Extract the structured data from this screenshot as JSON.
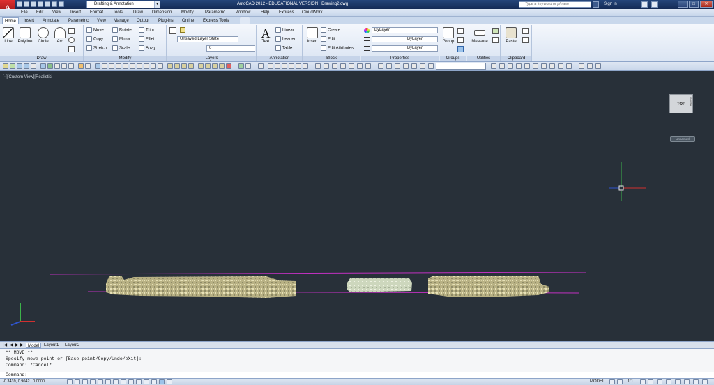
{
  "title_bar": {
    "app_title": "AutoCAD 2012 - EDUCATIONAL VERSION",
    "drawing_name": "Drawing2.dwg",
    "workspace": "Drafting & Annotation",
    "search_placeholder": "Type a keyword or phrase",
    "sign_in": "Sign In",
    "app_logo_letter": "A"
  },
  "menu": [
    "File",
    "Edit",
    "View",
    "Insert",
    "Format",
    "Tools",
    "Draw",
    "Dimension",
    "Modify",
    "Parametric",
    "Window",
    "Help",
    "Express",
    "CloudWorx"
  ],
  "ribbon_tabs": [
    "Home",
    "Insert",
    "Annotate",
    "Parametric",
    "View",
    "Manage",
    "Output",
    "Plug-ins",
    "Online",
    "Express Tools"
  ],
  "ribbon": {
    "draw": {
      "title": "Draw",
      "line": "Line",
      "polyline": "Polyline",
      "circle": "Circle",
      "arc": "Arc"
    },
    "modify": {
      "title": "Modify",
      "move": "Move",
      "rotate": "Rotate",
      "trim": "Trim",
      "copy": "Copy",
      "mirror": "Mirror",
      "fillet": "Fillet",
      "stretch": "Stretch",
      "scale": "Scale",
      "array": "Array"
    },
    "layers": {
      "title": "Layers",
      "layer_state": "Unsaved Layer State",
      "current_layer": "0"
    },
    "annotation": {
      "title": "Annotation",
      "text": "Text",
      "linear": "Linear",
      "leader": "Leader",
      "table": "Table"
    },
    "block": {
      "title": "Block",
      "insert": "Insert",
      "create": "Create",
      "edit": "Edit",
      "edit_attributes": "Edit Attributes"
    },
    "properties": {
      "title": "Properties",
      "color": "ByLayer",
      "linetype": "ByLayer",
      "lineweight": "ByLayer"
    },
    "groups": {
      "title": "Groups",
      "group": "Group"
    },
    "utilities": {
      "title": "Utilities",
      "measure": "Measure"
    },
    "clipboard": {
      "title": "Clipboard",
      "paste": "Paste"
    }
  },
  "viewport": {
    "label": "[−][Custom View][Realistic]",
    "viewcube_face": "TOP",
    "viewcube_side": "SOUTH",
    "wcs_label": "Unnamed"
  },
  "layout_tabs": [
    "Model",
    "Layout1",
    "Layout2"
  ],
  "command": {
    "lines": [
      "** MOVE **",
      "Specify move point or [Base point/Copy/Undo/eXit]:",
      "Command: *Cancel*"
    ],
    "prompt": "Command:"
  },
  "status": {
    "coordinates": "-0.3439, 0.9042 , 0.0000",
    "model": "MODEL",
    "annotation_scale": "1:1"
  },
  "colors": {
    "canvas": "#283039",
    "ribbon_blue": "#c9d8ec",
    "point_cloud": "#cfc89a",
    "magenta_line": "#c030c0"
  }
}
